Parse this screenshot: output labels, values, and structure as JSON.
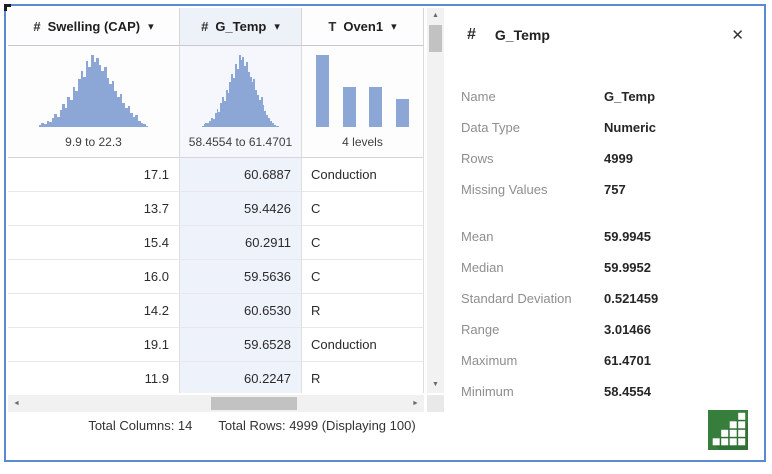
{
  "colors": {
    "window_border": "#5b8ad2",
    "histogram_bar": "#8ca6d5",
    "selected_header_bg": "#edf1f8",
    "selected_chart_bg": "#f5f7fc",
    "selected_cell_bg": "#eef2fb",
    "icon_green": "#377d3c"
  },
  "grid": {
    "columns": [
      {
        "type_icon": "#",
        "label": "Swelling (CAP)",
        "dropdown_icon": "▾",
        "range_label": "9.9 to 22.3",
        "selected": false,
        "chart": {
          "type": "histogram",
          "values": [
            0.03,
            0.05,
            0.04,
            0.08,
            0.07,
            0.12,
            0.18,
            0.14,
            0.24,
            0.32,
            0.27,
            0.42,
            0.38,
            0.56,
            0.5,
            0.66,
            0.78,
            0.7,
            0.92,
            0.84,
            1.0,
            0.9,
            0.96,
            0.86,
            0.78,
            0.84,
            0.68,
            0.6,
            0.64,
            0.5,
            0.42,
            0.46,
            0.34,
            0.26,
            0.29,
            0.2,
            0.14,
            0.16,
            0.09,
            0.06,
            0.04,
            0.02
          ]
        },
        "cells": [
          "17.1",
          "13.7",
          "15.4",
          "16.0",
          "14.2",
          "19.1",
          "11.9"
        ]
      },
      {
        "type_icon": "#",
        "label": "G_Temp",
        "dropdown_icon": "▾",
        "range_label": "58.4554 to 61.4701",
        "selected": true,
        "chart": {
          "type": "histogram",
          "values": [
            0.02,
            0.04,
            0.06,
            0.05,
            0.09,
            0.13,
            0.11,
            0.19,
            0.25,
            0.21,
            0.33,
            0.41,
            0.36,
            0.52,
            0.47,
            0.63,
            0.74,
            0.68,
            0.88,
            0.8,
            1.0,
            0.93,
            0.97,
            0.85,
            0.9,
            0.76,
            0.7,
            0.62,
            0.66,
            0.52,
            0.44,
            0.38,
            0.41,
            0.3,
            0.22,
            0.17,
            0.12,
            0.08,
            0.05,
            0.03,
            0.02,
            0.01
          ]
        },
        "cells": [
          "60.6887",
          "59.4426",
          "60.2911",
          "59.5636",
          "60.6530",
          "59.6528",
          "60.2247"
        ]
      },
      {
        "type_icon": "T",
        "label": "Oven1",
        "dropdown_icon": "▾",
        "range_label": "4 levels",
        "selected": false,
        "chart": {
          "type": "bar",
          "values": [
            1.0,
            0.56,
            0.55,
            0.39
          ]
        },
        "cells": [
          "Conduction",
          "C",
          "C",
          "C",
          "R",
          "Conduction",
          "R"
        ]
      }
    ],
    "scrollbar": {
      "up": "▲",
      "down": "▼",
      "left": "◄",
      "right": "►"
    },
    "footer": {
      "total_columns": "Total Columns: 14",
      "total_rows": "Total Rows: 4999 (Displaying 100)"
    }
  },
  "panel": {
    "type_icon": "#",
    "title": "G_Temp",
    "close_icon": "✕",
    "fields": [
      {
        "label": "Name",
        "value": "G_Temp"
      },
      {
        "label": "Data Type",
        "value": "Numeric"
      },
      {
        "label": "Rows",
        "value": "4999"
      },
      {
        "label": "Missing Values",
        "value": "757"
      },
      {
        "label": "Mean",
        "value": "59.9945"
      },
      {
        "label": "Median",
        "value": "59.9952"
      },
      {
        "label": "Standard Deviation",
        "value": "0.521459"
      },
      {
        "label": "Range",
        "value": "3.01466"
      },
      {
        "label": "Maximum",
        "value": "61.4701"
      },
      {
        "label": "Minimum",
        "value": "58.4554"
      }
    ]
  }
}
